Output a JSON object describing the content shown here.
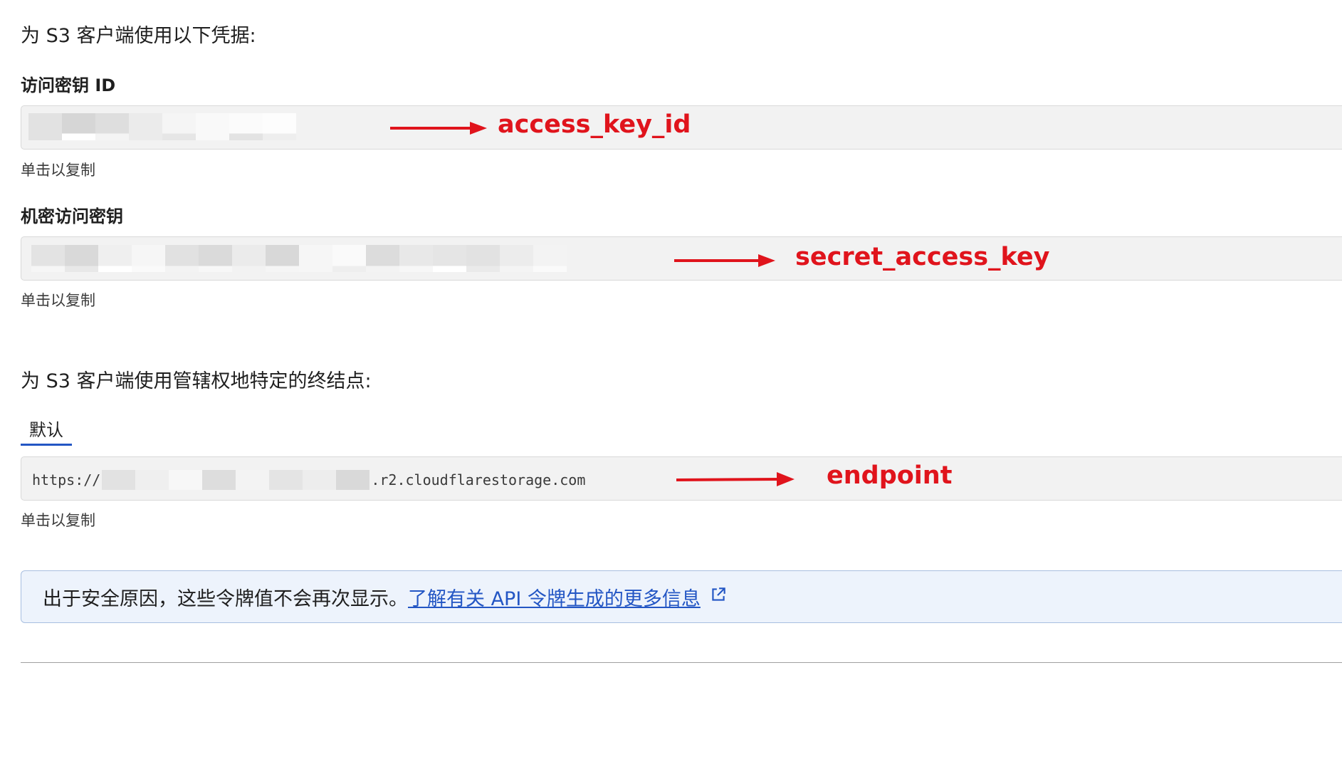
{
  "credentials_heading": "为 S3 客户端使用以下凭据:",
  "access_key": {
    "label": "访问密钥 ID",
    "copy_hint": "单击以复制",
    "annotation": "access_key_id"
  },
  "secret_key": {
    "label": "机密访问密钥",
    "copy_hint": "单击以复制",
    "annotation": "secret_access_key"
  },
  "endpoint_heading": "为 S3 客户端使用管辖权地特定的终结点:",
  "endpoint_tab": "默认",
  "endpoint": {
    "prefix": "https://",
    "suffix": ".r2.cloudflarestorage.com",
    "copy_hint": "单击以复制",
    "annotation": "endpoint"
  },
  "notice": {
    "text": "出于安全原因，这些令牌值不会再次显示。",
    "link": "了解有关 API 令牌生成的更多信息",
    "link_icon": "external-link-icon"
  },
  "colors": {
    "annotation_red": "#e0141c",
    "link_blue": "#2356c4",
    "notice_bg": "#edf3fc",
    "field_bg": "#f2f2f2"
  }
}
